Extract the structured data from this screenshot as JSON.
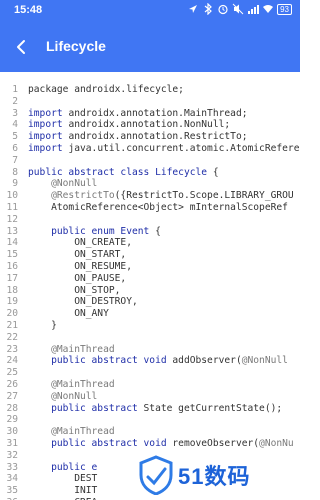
{
  "status": {
    "time": "15:48",
    "battery": "93"
  },
  "appbar": {
    "title": "Lifecycle"
  },
  "code": {
    "lines": [
      {
        "n": "1",
        "t": [
          {
            "k": "plain",
            "s": "package androidx.lifecycle;"
          }
        ]
      },
      {
        "n": "2",
        "t": []
      },
      {
        "n": "3",
        "t": [
          {
            "k": "kw",
            "s": "import "
          },
          {
            "k": "plain",
            "s": "androidx.annotation.MainThread;"
          }
        ]
      },
      {
        "n": "4",
        "t": [
          {
            "k": "kw",
            "s": "import "
          },
          {
            "k": "plain",
            "s": "androidx.annotation.NonNull;"
          }
        ]
      },
      {
        "n": "5",
        "t": [
          {
            "k": "kw",
            "s": "import "
          },
          {
            "k": "plain",
            "s": "androidx.annotation.RestrictTo;"
          }
        ]
      },
      {
        "n": "6",
        "t": [
          {
            "k": "kw",
            "s": "import "
          },
          {
            "k": "plain",
            "s": "java.util.concurrent.atomic.AtomicRefere"
          }
        ]
      },
      {
        "n": "7",
        "t": []
      },
      {
        "n": "8",
        "t": [
          {
            "k": "kw",
            "s": "public abstract class "
          },
          {
            "k": "kw",
            "s": "Lifecycle "
          },
          {
            "k": "plain",
            "s": "{"
          }
        ]
      },
      {
        "n": "9",
        "t": [
          {
            "k": "ann",
            "s": "    @NonNull"
          }
        ]
      },
      {
        "n": "10",
        "t": [
          {
            "k": "ann",
            "s": "    @RestrictTo"
          },
          {
            "k": "plain",
            "s": "({RestrictTo.Scope.LIBRARY_GROU"
          }
        ]
      },
      {
        "n": "11",
        "t": [
          {
            "k": "plain",
            "s": "    AtomicReference<Object> mInternalScopeRef"
          }
        ]
      },
      {
        "n": "12",
        "t": []
      },
      {
        "n": "13",
        "t": [
          {
            "k": "kw",
            "s": "    public enum "
          },
          {
            "k": "kw",
            "s": "Event "
          },
          {
            "k": "plain",
            "s": "{"
          }
        ]
      },
      {
        "n": "14",
        "t": [
          {
            "k": "plain",
            "s": "        ON_CREATE,"
          }
        ]
      },
      {
        "n": "15",
        "t": [
          {
            "k": "plain",
            "s": "        ON_START,"
          }
        ]
      },
      {
        "n": "16",
        "t": [
          {
            "k": "plain",
            "s": "        ON_RESUME,"
          }
        ]
      },
      {
        "n": "17",
        "t": [
          {
            "k": "plain",
            "s": "        ON_PAUSE,"
          }
        ]
      },
      {
        "n": "18",
        "t": [
          {
            "k": "plain",
            "s": "        ON_STOP,"
          }
        ]
      },
      {
        "n": "19",
        "t": [
          {
            "k": "plain",
            "s": "        ON_DESTROY,"
          }
        ]
      },
      {
        "n": "20",
        "t": [
          {
            "k": "plain",
            "s": "        ON_ANY"
          }
        ]
      },
      {
        "n": "21",
        "t": [
          {
            "k": "plain",
            "s": "    }"
          }
        ]
      },
      {
        "n": "22",
        "t": []
      },
      {
        "n": "23",
        "t": [
          {
            "k": "ann",
            "s": "    @MainThread"
          }
        ]
      },
      {
        "n": "24",
        "t": [
          {
            "k": "kw",
            "s": "    public abstract void "
          },
          {
            "k": "plain",
            "s": "addObserver("
          },
          {
            "k": "ann",
            "s": "@NonNull"
          }
        ]
      },
      {
        "n": "25",
        "t": []
      },
      {
        "n": "26",
        "t": [
          {
            "k": "ann",
            "s": "    @MainThread"
          }
        ]
      },
      {
        "n": "27",
        "t": [
          {
            "k": "ann",
            "s": "    @NonNull"
          }
        ]
      },
      {
        "n": "28",
        "t": [
          {
            "k": "kw",
            "s": "    public abstract "
          },
          {
            "k": "plain",
            "s": "State getCurrentState();"
          }
        ]
      },
      {
        "n": "29",
        "t": []
      },
      {
        "n": "30",
        "t": [
          {
            "k": "ann",
            "s": "    @MainThread"
          }
        ]
      },
      {
        "n": "31",
        "t": [
          {
            "k": "kw",
            "s": "    public abstract void "
          },
          {
            "k": "plain",
            "s": "removeObserver("
          },
          {
            "k": "ann",
            "s": "@NonNu"
          }
        ]
      },
      {
        "n": "32",
        "t": []
      },
      {
        "n": "33",
        "t": [
          {
            "k": "kw",
            "s": "    public e"
          }
        ]
      },
      {
        "n": "34",
        "t": [
          {
            "k": "plain",
            "s": "        DEST"
          }
        ]
      },
      {
        "n": "35",
        "t": [
          {
            "k": "plain",
            "s": "        INIT"
          }
        ]
      },
      {
        "n": "36",
        "t": [
          {
            "k": "plain",
            "s": "        CREA"
          }
        ]
      }
    ]
  },
  "watermark": {
    "text": "51数码"
  }
}
